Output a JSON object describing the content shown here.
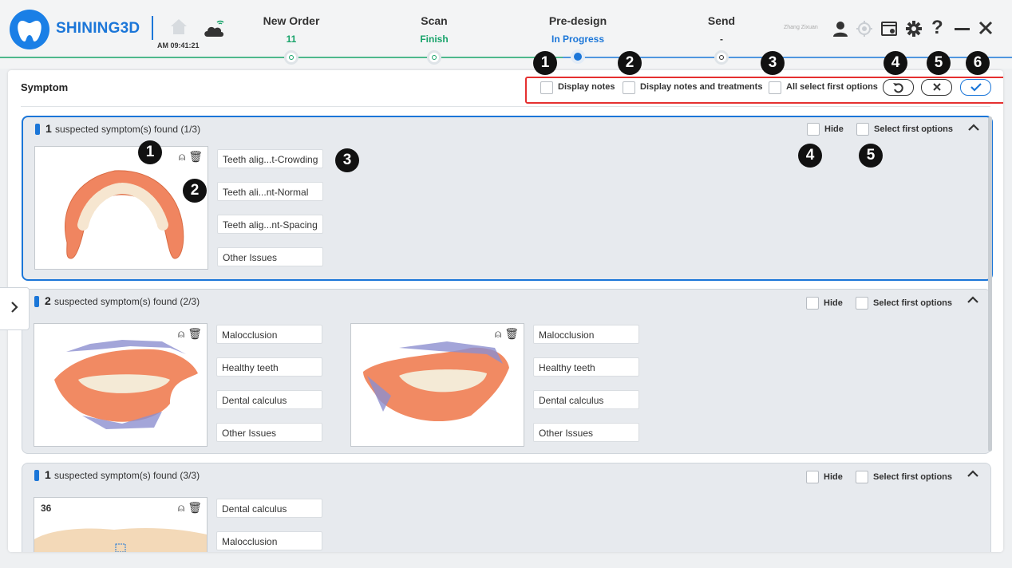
{
  "header": {
    "brand": "SHINING3D",
    "clock": "AM 09:41:21",
    "user": "Zhang Zixuan",
    "steps": [
      {
        "title": "New Order",
        "status": "11",
        "status_color": "#18a36a"
      },
      {
        "title": "Scan",
        "status": "Finish",
        "status_color": "#18a36a"
      },
      {
        "title": "Pre-design",
        "status": "In Progress",
        "status_color": "#1b76d8"
      },
      {
        "title": "Send",
        "status": "-",
        "status_color": "#333333"
      }
    ]
  },
  "panel": {
    "title": "Symptom",
    "toolbar": {
      "display_notes": "Display notes",
      "display_notes_treatments": "Display notes and treatments",
      "all_select_first": "All select first options"
    }
  },
  "groups": [
    {
      "count": "1",
      "title": "suspected symptom(s) found (1/3)",
      "hide": "Hide",
      "select_first": "Select first options",
      "tags": [
        "Teeth alig...t-Crowding",
        "Teeth ali...nt-Normal",
        "Teeth alig...nt-Spacing",
        "Other Issues"
      ]
    },
    {
      "count": "2",
      "title": "suspected symptom(s) found (2/3)",
      "hide": "Hide",
      "select_first": "Select first options",
      "tags_a": [
        "Malocclusion",
        "Healthy teeth",
        "Dental calculus",
        "Other Issues"
      ],
      "tags_b": [
        "Malocclusion",
        "Healthy teeth",
        "Dental calculus",
        "Other Issues"
      ]
    },
    {
      "count": "1",
      "title": "suspected symptom(s) found (3/3)",
      "hide": "Hide",
      "select_first": "Select first options",
      "tooth_no": "36",
      "tags": [
        "Dental calculus",
        "Malocclusion"
      ]
    }
  ],
  "badges": {
    "top": [
      "1",
      "2",
      "3",
      "4",
      "5",
      "6"
    ],
    "group": [
      "1",
      "2",
      "3",
      "4",
      "5"
    ]
  },
  "colors": {
    "accent": "#1b76d8",
    "done": "#18a36a",
    "highlight": "#e53030"
  }
}
